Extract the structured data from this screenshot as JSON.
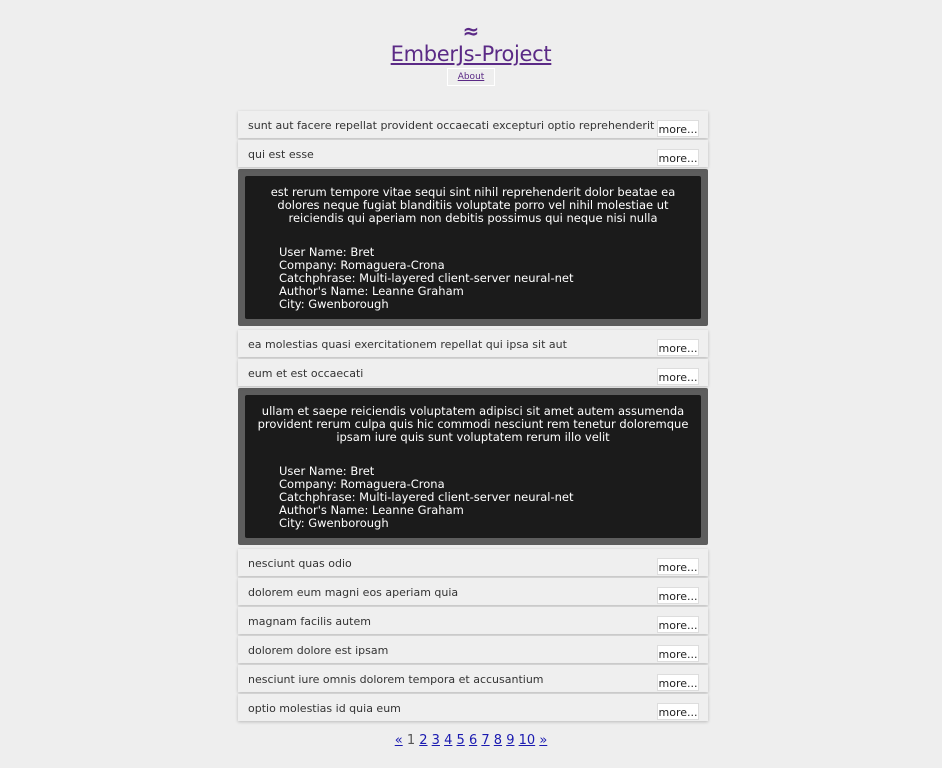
{
  "header": {
    "logo_glyph": "≈",
    "title": "EmberJs-Project",
    "about_label": "About"
  },
  "more_label": "more...",
  "posts": [
    {
      "title": "sunt aut facere repellat provident occaecati excepturi optio reprehenderit"
    },
    {
      "title": "qui est esse"
    },
    {
      "title": "ea molestias quasi exercitationem repellat qui ipsa sit aut"
    },
    {
      "title": "eum et est occaecati"
    },
    {
      "title": "nesciunt quas odio"
    },
    {
      "title": "dolorem eum magni eos aperiam quia"
    },
    {
      "title": "magnam facilis autem"
    },
    {
      "title": "dolorem dolore est ipsam"
    },
    {
      "title": "nesciunt iure omnis dolorem tempora et accusantium"
    },
    {
      "title": "optio molestias id quia eum"
    }
  ],
  "details": [
    {
      "body": "est rerum tempore vitae sequi sint nihil reprehenderit dolor beatae ea dolores neque fugiat blanditiis voluptate porro vel nihil molestiae ut reiciendis qui aperiam non debitis possimus qui neque nisi nulla",
      "user_name": "User Name: Bret",
      "company": "Company: Romaguera-Crona",
      "catchphrase": "Catchphrase: Multi-layered client-server neural-net",
      "author_name": "Author's Name: Leanne Graham",
      "city": "City: Gwenborough"
    },
    {
      "body": "ullam et saepe reiciendis voluptatem adipisci sit amet autem assumenda provident rerum culpa quis hic commodi nesciunt rem tenetur doloremque ipsam iure quis sunt voluptatem rerum illo velit",
      "user_name": "User Name: Bret",
      "company": "Company: Romaguera-Crona",
      "catchphrase": "Catchphrase: Multi-layered client-server neural-net",
      "author_name": "Author's Name: Leanne Graham",
      "city": "City: Gwenborough"
    }
  ],
  "pagination": {
    "prev": "«",
    "current": "1",
    "pages": [
      "2",
      "3",
      "4",
      "5",
      "6",
      "7",
      "8",
      "9",
      "10"
    ],
    "next": "»"
  }
}
